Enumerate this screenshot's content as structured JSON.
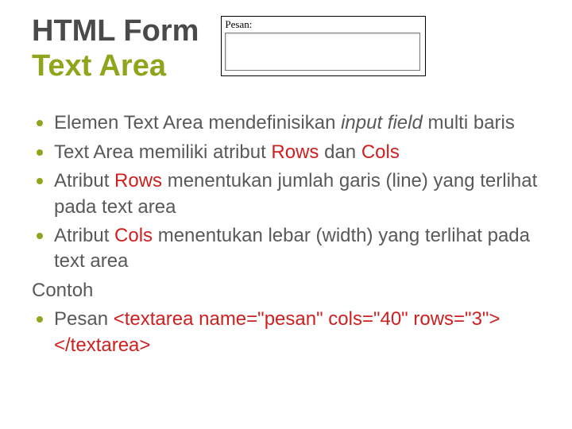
{
  "title": {
    "line1": "HTML Form",
    "line2": "Text Area"
  },
  "example": {
    "label": "Pesan:"
  },
  "bullets": [
    {
      "pre": "Elemen Text Area mendefinisikan ",
      "em": "input field",
      "post": " multi baris"
    },
    {
      "pre": "Text Area memiliki atribut ",
      "kw1": "Rows",
      "mid": " dan ",
      "kw2": "Cols",
      "post": ""
    },
    {
      "pre": "Atribut ",
      "kw1": "Rows",
      "post": " menentukan jumlah garis (line) yang terlihat pada text area"
    },
    {
      "pre": " Atribut ",
      "kw1": "Cols",
      "post": " menentukan lebar (width) yang terlihat pada text area"
    }
  ],
  "contoh_label": "Contoh",
  "contoh_bullet": {
    "pre": "Pesan ",
    "code": "<textarea name=\"pesan\" cols=\"40\" rows=\"3\"></textarea>"
  }
}
